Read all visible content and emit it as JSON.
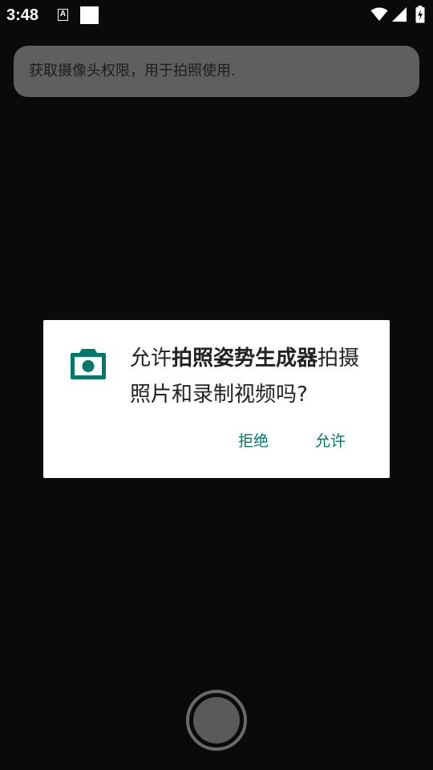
{
  "status_bar": {
    "time": "3:48",
    "notification_icons": [
      "a-icon",
      "square-icon"
    ],
    "system_icons": [
      "wifi-icon",
      "signal-icon",
      "battery-charging-icon"
    ]
  },
  "toast": {
    "text": "获取摄像头权限，用于拍照使用."
  },
  "permission_dialog": {
    "icon": "camera-icon",
    "message_prefix": "允许",
    "app_name": "拍照姿势生成器",
    "message_suffix": "拍摄照片和录制视频吗?",
    "deny_label": "拒绝",
    "allow_label": "允许",
    "accent_color": "#00796b"
  },
  "camera": {
    "shutter_icon": "shutter-button"
  }
}
